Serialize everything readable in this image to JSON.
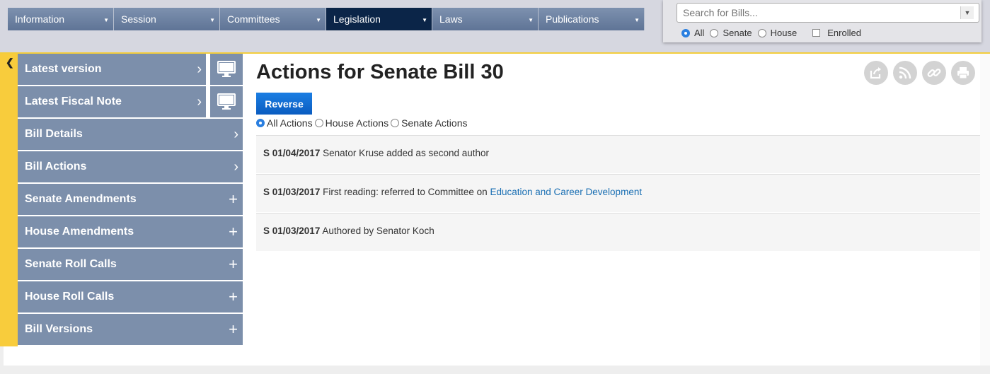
{
  "topnav": [
    {
      "label": "Information"
    },
    {
      "label": "Session"
    },
    {
      "label": "Committees"
    },
    {
      "label": "Legislation",
      "active": true
    },
    {
      "label": "Laws"
    },
    {
      "label": "Publications"
    }
  ],
  "search": {
    "placeholder": "Search for Bills...",
    "scopes": [
      {
        "label": "All",
        "selected": true
      },
      {
        "label": "Senate"
      },
      {
        "label": "House"
      }
    ],
    "enrolled_label": "Enrolled"
  },
  "sidebar": {
    "items": [
      {
        "label": "Latest version",
        "icon": "chevron-right-icon"
      },
      {
        "label": "Latest Fiscal Note",
        "icon": "chevron-right-icon"
      },
      {
        "label": "Bill Details",
        "icon": "chevron-right-icon"
      },
      {
        "label": "Bill Actions",
        "icon": "chevron-right-icon"
      },
      {
        "label": "Senate Amendments",
        "icon": "plus-icon"
      },
      {
        "label": "House Amendments",
        "icon": "plus-icon"
      },
      {
        "label": "Senate Roll Calls",
        "icon": "plus-icon"
      },
      {
        "label": "House Roll Calls",
        "icon": "plus-icon"
      },
      {
        "label": "Bill Versions",
        "icon": "plus-icon"
      }
    ]
  },
  "main": {
    "title": "Actions for Senate Bill 30",
    "reverse_label": "Reverse",
    "filters": [
      {
        "label": "All Actions",
        "selected": true
      },
      {
        "label": "House Actions"
      },
      {
        "label": "Senate Actions"
      }
    ],
    "actions": [
      {
        "prefix": "S 01/04/2017",
        "text": "Senator Kruse added as second author",
        "link": ""
      },
      {
        "prefix": "S 01/03/2017",
        "text": "First reading: referred to Committee on",
        "link": "Education and Career Development"
      },
      {
        "prefix": "S 01/03/2017",
        "text": "Authored by Senator Koch",
        "link": ""
      }
    ]
  },
  "colors": {
    "nav": "#6f84a4",
    "nav_active": "#0b2548",
    "sidebar": "#7c8fab",
    "accent": "#f8cc3c",
    "button": "#1170d6",
    "link": "#1a6fb3"
  }
}
